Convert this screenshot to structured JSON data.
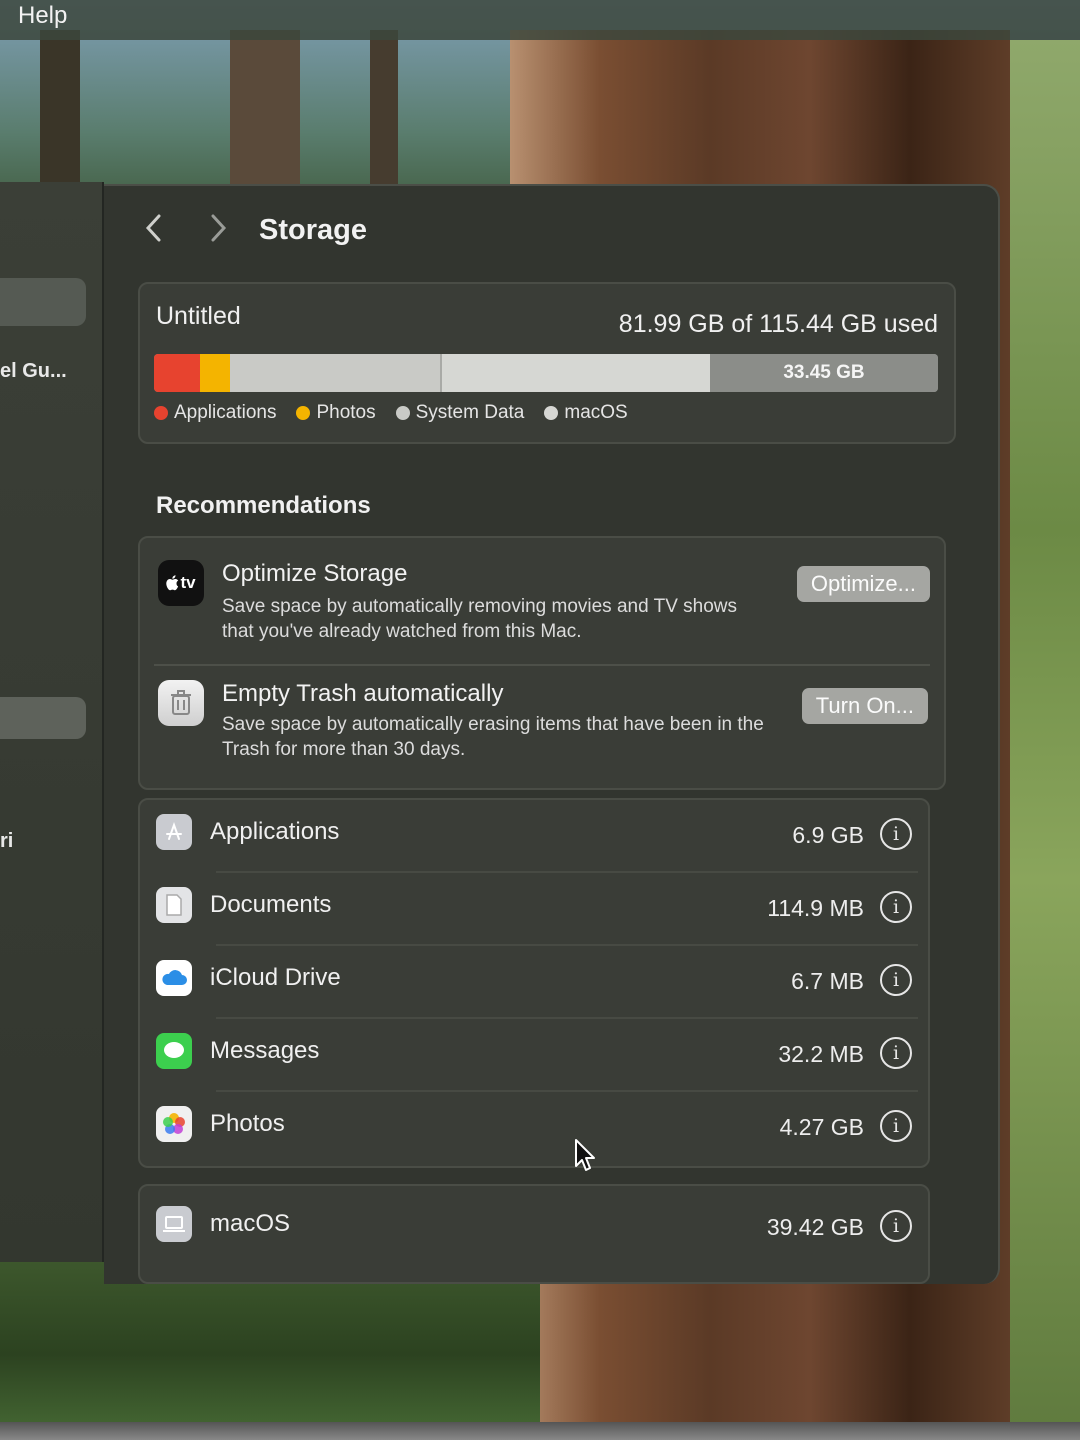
{
  "menubar": {
    "help_label": "Help"
  },
  "sidebar": {
    "partial_item_1": "el Gu...",
    "partial_item_2": "ri"
  },
  "window": {
    "title": "Storage"
  },
  "storage": {
    "volume_name": "Untitled",
    "usage_text": "81.99 GB of 115.44 GB used",
    "free_label": "33.45 GB",
    "legend": [
      {
        "label": "Applications",
        "color": "#e7432f"
      },
      {
        "label": "Photos",
        "color": "#f4b400"
      },
      {
        "label": "System Data",
        "color": "#c9cac6"
      },
      {
        "label": "macOS",
        "color": "#d6d7d3"
      }
    ]
  },
  "recommendations": {
    "heading": "Recommendations",
    "items": [
      {
        "icon": "apple-tv-icon",
        "icon_text": "tv",
        "title": "Optimize Storage",
        "description": "Save space by automatically removing movies and TV shows that you've already watched from this Mac.",
        "button": "Optimize..."
      },
      {
        "icon": "trash-icon",
        "title": "Empty Trash automatically",
        "description": "Save space by automatically erasing items that have been in the Trash for more than 30 days.",
        "button": "Turn On..."
      }
    ]
  },
  "categories": [
    {
      "name": "Applications",
      "size": "6.9 GB",
      "icon": "app-store-icon",
      "color": "#c9cbd0"
    },
    {
      "name": "Documents",
      "size": "114.9 MB",
      "icon": "document-icon",
      "color": "#e3e4e6"
    },
    {
      "name": "iCloud Drive",
      "size": "6.7 MB",
      "icon": "icloud-icon",
      "color": "#2b8ee6"
    },
    {
      "name": "Messages",
      "size": "32.2 MB",
      "icon": "messages-icon",
      "color": "#3ccf4e"
    },
    {
      "name": "Photos",
      "size": "4.27 GB",
      "icon": "photos-icon",
      "color": "#f0f0f0"
    }
  ],
  "macos_row": {
    "name": "macOS",
    "size": "39.42 GB",
    "icon": "laptop-icon"
  },
  "info_glyph": "i"
}
